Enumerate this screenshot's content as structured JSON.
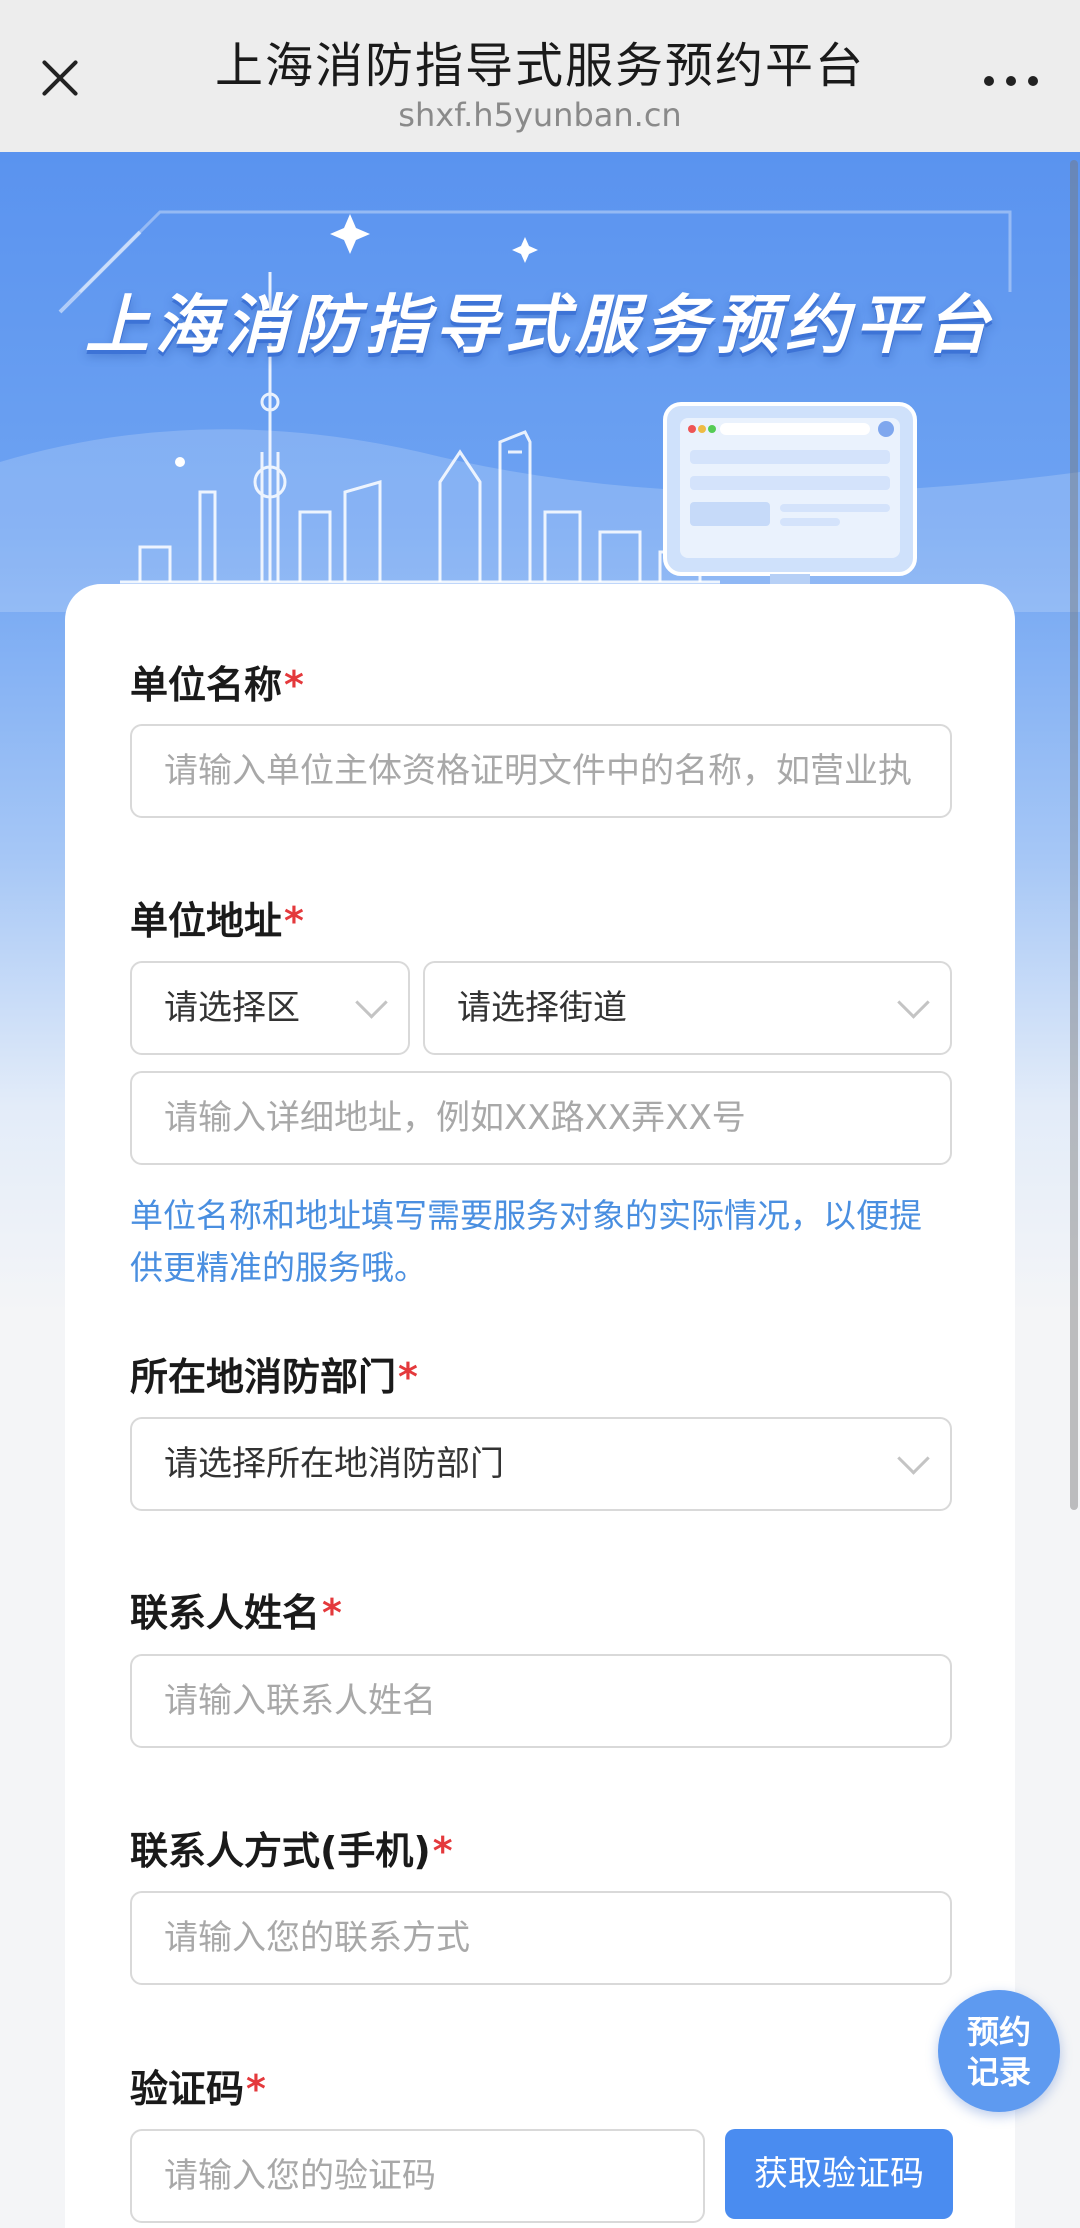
{
  "nav": {
    "title": "上海消防指导式服务预约平台",
    "url": "shxf.h5yunban.cn",
    "close_icon": "close-icon",
    "more_icon": "more-icon"
  },
  "banner": {
    "title": "上海消防指导式服务预约平台"
  },
  "form": {
    "unit_name": {
      "label": "单位名称",
      "required_mark": "*",
      "placeholder": "请输入单位主体资格证明文件中的名称，如营业执"
    },
    "unit_address": {
      "label": "单位地址",
      "required_mark": "*",
      "district": "请选择区",
      "street": "请选择街道",
      "detail_placeholder": "请输入详细地址，例如XX路XX弄XX号",
      "hint": "单位名称和地址填写需要服务对象的实际情况，以便提供更精准的服务哦。"
    },
    "fire_department": {
      "label": "所在地消防部门",
      "required_mark": "*",
      "value": "请选择所在地消防部门"
    },
    "contact_name": {
      "label": "联系人姓名",
      "required_mark": "*",
      "placeholder": "请输入联系人姓名"
    },
    "contact_phone": {
      "label": "联系人方式(手机)",
      "required_mark": "*",
      "placeholder": "请输入您的联系方式"
    },
    "verify_code": {
      "label": "验证码",
      "required_mark": "*",
      "placeholder": "请输入您的验证码",
      "button": "获取验证码"
    }
  },
  "float_button": {
    "line1": "预约",
    "line2": "记录"
  },
  "colors": {
    "accent": "#4a8cf0",
    "required": "#e4393c",
    "hint": "#4a8fe0"
  }
}
